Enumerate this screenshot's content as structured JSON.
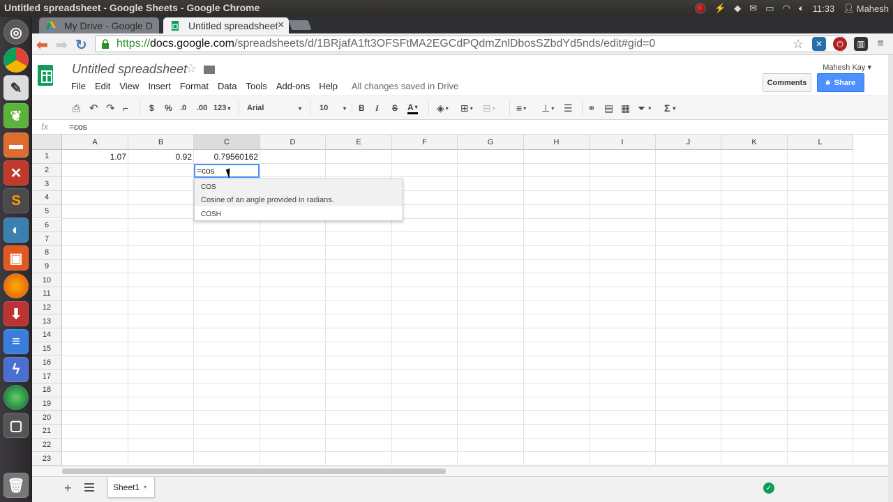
{
  "system_bar": {
    "window_title": "Untitled spreadsheet - Google Sheets - Google Chrome",
    "time": "11:33",
    "user": "Mahesh"
  },
  "browser": {
    "tabs": [
      {
        "label": "My Drive - Google D",
        "active": false
      },
      {
        "label": "Untitled spreadsheet",
        "active": true
      }
    ],
    "url_scheme": "https://",
    "url_host": "docs.google.com",
    "url_path": "/spreadsheets/d/1BRjafA1ft3OFSFtMA2EGCdPQdmZnlDbosSZbdYd5nds/edit#gid=0"
  },
  "sheets": {
    "title": "Untitled spreadsheet",
    "menus": [
      "File",
      "Edit",
      "View",
      "Insert",
      "Format",
      "Data",
      "Tools",
      "Add-ons",
      "Help"
    ],
    "save_status": "All changes saved in Drive",
    "account": "Mahesh Kay",
    "comments_label": "Comments",
    "share_label": "Share"
  },
  "toolbar": {
    "currency": "$",
    "percent": "%",
    "dec_less": ".0",
    "dec_more": ".00",
    "more_formats": "123",
    "font": "Arial",
    "font_size": "10",
    "bold": "B",
    "italic": "I",
    "strike": "S",
    "text_color": "A",
    "sum": "Σ"
  },
  "formula_bar": {
    "fx_label": "fx",
    "value": "=cos"
  },
  "grid": {
    "columns": [
      "A",
      "B",
      "C",
      "D",
      "E",
      "F",
      "G",
      "H",
      "I",
      "J",
      "K",
      "L"
    ],
    "rows": [
      "1",
      "2",
      "3",
      "4",
      "5",
      "6",
      "7",
      "8",
      "9",
      "10",
      "11",
      "12",
      "13",
      "14",
      "15",
      "16",
      "17",
      "18",
      "19",
      "20",
      "21",
      "22",
      "23"
    ],
    "cells": {
      "A1": "1.07",
      "B1": "0.92",
      "C1": "0.79560162"
    },
    "active_cell_value": "=cos",
    "autocomplete": {
      "items": [
        "COS",
        "COSH"
      ],
      "description": "Cosine of an angle provided in radians."
    }
  },
  "sheet_tabs": {
    "active": "Sheet1"
  },
  "colors": {
    "accent_blue": "#4d90fe",
    "sheets_green": "#0f9d58"
  }
}
